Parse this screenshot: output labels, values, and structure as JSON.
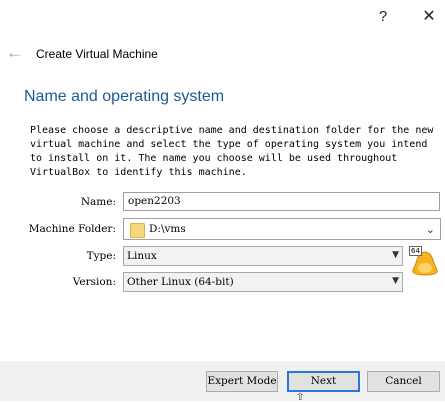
{
  "titlebar": {
    "help_icon": "?",
    "close_icon": "✕"
  },
  "wizard": {
    "title": "Create Virtual Machine",
    "back_icon": "←"
  },
  "section": {
    "title": "Name and operating system",
    "description": "Please choose a descriptive name and destination folder for the new\nvirtual machine and select the type of operating system you intend\nto install on it. The name you choose will be used throughout\nVirtualBox to identify this machine."
  },
  "form": {
    "name_label": "Name:",
    "name_value": "open2203",
    "folder_label": "Machine Folder:",
    "folder_value": "D:\\vms",
    "type_label": "Type:",
    "type_value": "Linux",
    "version_label": "Version:",
    "version_value": "Other Linux (64-bit)",
    "os_badge": "64"
  },
  "buttons": {
    "expert": "Expert Mode",
    "next": "Next",
    "cancel": "Cancel"
  },
  "colors": {
    "section_title": "#1c5a97",
    "focus_border": "#2a78d6",
    "footer_bg": "#f0f0f0"
  }
}
